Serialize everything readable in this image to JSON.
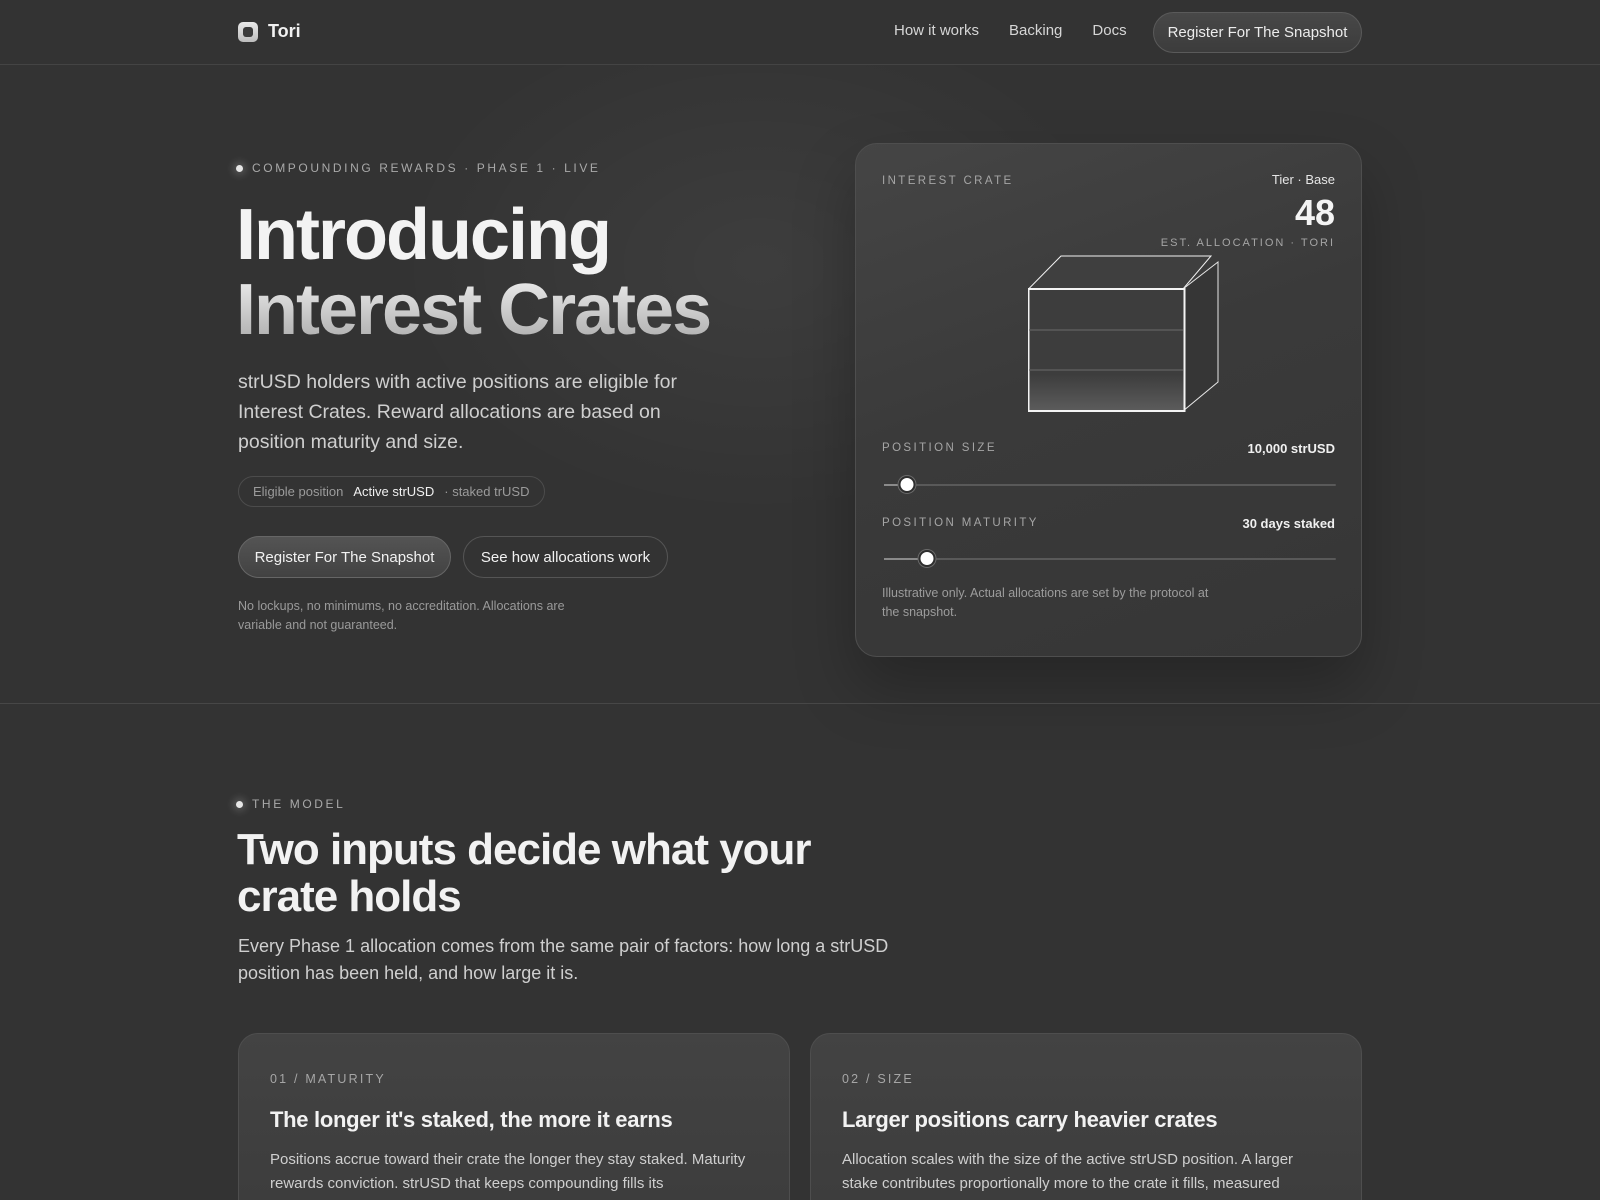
{
  "brand": {
    "name": "Tori",
    "logo_icon": "tori-logo-icon"
  },
  "nav": {
    "links": [
      "How it works",
      "Backing",
      "Docs"
    ],
    "cta_label": "Register For The Snapshot"
  },
  "hero": {
    "eyebrow": "COMPOUNDING REWARDS · PHASE 1 · LIVE",
    "title_line1": "Introducing",
    "title_line2": "Interest Crates",
    "description": "strUSD holders with active positions are eligible for Interest Crates. Reward allocations are based on position maturity and size.",
    "eligibility": {
      "label": "Eligible position",
      "value": "Active strUSD",
      "suffix": "· staked trUSD"
    },
    "primary_cta": "Register For The Snapshot",
    "secondary_cta": "See how allocations work",
    "fine_print": "No lockups, no minimums, no accreditation. Allocations are variable and not guaranteed."
  },
  "crate_card": {
    "label": "INTEREST CRATE",
    "tier": "Tier · Base",
    "allocation_value": "48",
    "allocation_caption": "EST. ALLOCATION · TORI",
    "crate_icon": "crate-box-icon",
    "position_size": {
      "label": "POSITION SIZE",
      "value": "10,000 strUSD",
      "slider_level": 0.05
    },
    "position_maturity": {
      "label": "POSITION MATURITY",
      "value": "30 days staked",
      "slider_level": 0.095
    },
    "note": "Illustrative only. Actual allocations are set by the protocol at the snapshot."
  },
  "model": {
    "eyebrow": "THE MODEL",
    "title": "Two inputs decide what your crate holds",
    "description": "Every Phase 1 allocation comes from the same pair of factors: how long a strUSD position has been held, and how large it is.",
    "cards": [
      {
        "eyebrow": "01 / MATURITY",
        "title": "The longer it's staked, the more it earns",
        "body": "Positions accrue toward their crate the longer they stay staked. Maturity rewards conviction. strUSD that keeps compounding fills its"
      },
      {
        "eyebrow": "02 / SIZE",
        "title": "Larger positions carry heavier crates",
        "body": "Allocation scales with the size of the active strUSD position. A larger stake contributes proportionally more to the crate it fills, measured"
      }
    ]
  },
  "colors": {
    "background": "#333333",
    "surface": "#3b3b3b",
    "text": "#ececec",
    "muted": "#a6a6a6"
  }
}
